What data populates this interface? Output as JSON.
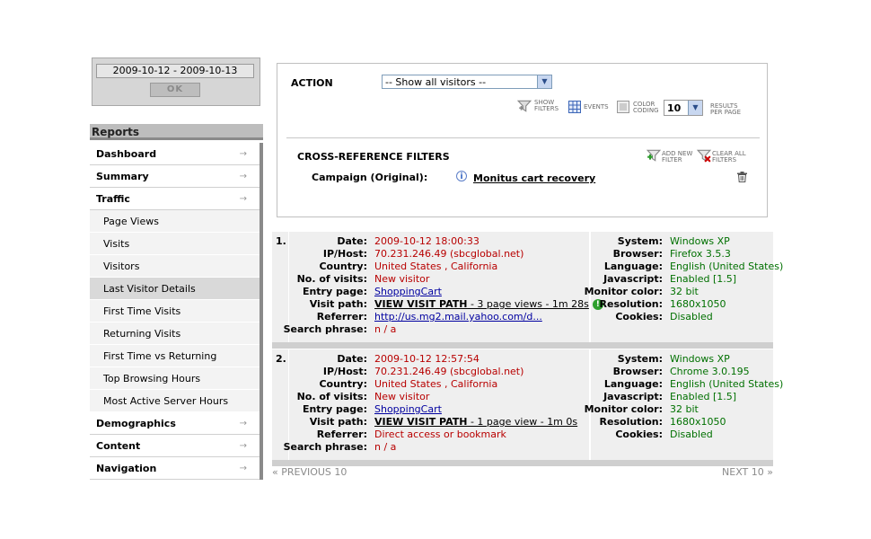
{
  "date_picker": {
    "range": "2009-10-12 - 2009-10-13",
    "ok_label": "OK"
  },
  "sidebar": {
    "header": "Reports",
    "items": [
      {
        "label": "Dashboard",
        "type": "main"
      },
      {
        "label": "Summary",
        "type": "main"
      },
      {
        "label": "Traffic",
        "type": "main_open"
      },
      {
        "label": "Page Views",
        "type": "sub"
      },
      {
        "label": "Visits",
        "type": "sub"
      },
      {
        "label": "Visitors",
        "type": "sub"
      },
      {
        "label": "Last Visitor Details",
        "type": "sub",
        "active": true
      },
      {
        "label": "First Time Visits",
        "type": "sub"
      },
      {
        "label": "Returning Visits",
        "type": "sub"
      },
      {
        "label": "First Time vs Returning",
        "type": "sub"
      },
      {
        "label": "Top Browsing Hours",
        "type": "sub"
      },
      {
        "label": "Most Active Server Hours",
        "type": "sub"
      },
      {
        "label": "Demographics",
        "type": "main"
      },
      {
        "label": "Content",
        "type": "main"
      },
      {
        "label": "Navigation",
        "type": "main"
      }
    ],
    "arrow": "→"
  },
  "filters": {
    "action_label": "ACTION",
    "action_value": "-- Show all visitors --",
    "show_filters": [
      "SHOW",
      "FILTERS"
    ],
    "events": "EVENTS",
    "color_coding": [
      "COLOR",
      "CODING"
    ],
    "results_value": "10",
    "results_label": [
      "RESULTS",
      "PER PAGE"
    ],
    "xref_label": "CROSS-REFERENCE FILTERS",
    "add_filter": [
      "ADD NEW",
      "FILTER"
    ],
    "clear_filters": [
      "CLEAR ALL",
      "FILTERS"
    ],
    "campaign_label": "Campaign (Original):",
    "campaign_value": "Monitus cart recovery"
  },
  "labels": {
    "date": "Date:",
    "ip": "IP/Host:",
    "country": "Country:",
    "visits": "No. of visits:",
    "entry": "Entry page:",
    "path": "Visit path:",
    "referrer": "Referrer:",
    "search": "Search phrase:",
    "system": "System:",
    "browser": "Browser:",
    "language": "Language:",
    "javascript": "Javascript:",
    "monitor": "Monitor color:",
    "resolution": "Resolution:",
    "cookies": "Cookies:"
  },
  "records": [
    {
      "num": "1.",
      "date": "2009-10-12 18:00:33",
      "ip": "70.231.246.49 (sbcglobal.net)",
      "country": "United States , California",
      "visits": "New visitor",
      "entry": "ShoppingCart",
      "path_link": "VIEW VISIT PATH",
      "path_detail": " - 3 page views - 1m 28s",
      "referrer": "http://us.mg2.mail.yahoo.com/d...",
      "search": "n / a",
      "system": "Windows XP",
      "browser": "Firefox 3.5.3",
      "language": "English (United States)",
      "javascript": "Enabled [1.5]",
      "monitor": "32 bit",
      "resolution": "1680x1050",
      "cookies": "Disabled"
    },
    {
      "num": "2.",
      "date": "2009-10-12 12:57:54",
      "ip": "70.231.246.49 (sbcglobal.net)",
      "country": "United States , California",
      "visits": "New visitor",
      "entry": "ShoppingCart",
      "path_link": "VIEW VISIT PATH",
      "path_detail": " - 1 page view - 1m 0s",
      "referrer": "Direct access or bookmark",
      "search": "n / a",
      "system": "Windows XP",
      "browser": "Chrome 3.0.195",
      "language": "English (United States)",
      "javascript": "Enabled [1.5]",
      "monitor": "32 bit",
      "resolution": "1680x1050",
      "cookies": "Disabled"
    }
  ],
  "pager": {
    "prev": "« PREVIOUS 10",
    "next": "NEXT 10 »"
  }
}
